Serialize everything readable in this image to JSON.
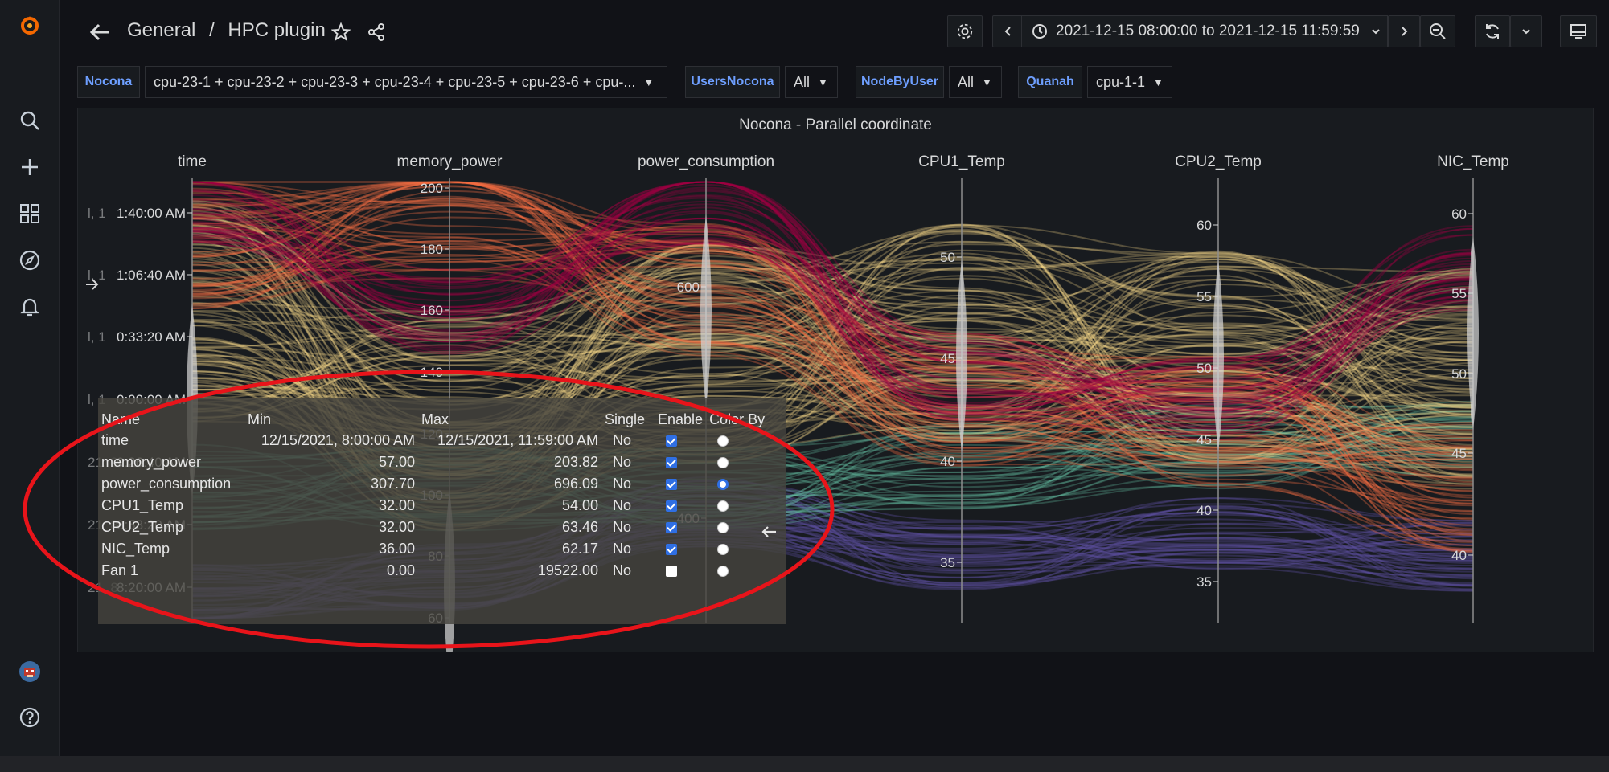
{
  "header": {
    "breadcrumb_folder": "General",
    "breadcrumb_sep": "/",
    "dashboard_title": "HPC plugin",
    "time_range": "2021-12-15 08:00:00 to 2021-12-15 11:59:59"
  },
  "variables": [
    {
      "label": "Nocona",
      "value": "cpu-23-1 + cpu-23-2 + cpu-23-3 + cpu-23-4 + cpu-23-5 + cpu-23-6 + cpu-..."
    },
    {
      "label": "UsersNocona",
      "value": "All"
    },
    {
      "label": "NodeByUser",
      "value": "All"
    },
    {
      "label": "Quanah",
      "value": "cpu-1-1"
    }
  ],
  "panel": {
    "title": "Nocona - Parallel coordinate"
  },
  "chart_data": {
    "type": "parallel-coordinates",
    "title": "Nocona - Parallel coordinate",
    "axes": [
      {
        "name": "time",
        "ticks": [
          "1:40:00 AM",
          "1:06:40 AM",
          "0:33:20 AM",
          "0:00:00 AM",
          "9:26:40 AM",
          "8:53:20 AM",
          "8:20:00 AM"
        ],
        "tick_prefix": [
          "l, 1",
          "l, 1",
          "l, 1",
          "l, 1",
          "21, 9",
          "21, 8",
          "21, 8"
        ]
      },
      {
        "name": "memory_power",
        "ticks": [
          "200",
          "180",
          "160",
          "140",
          "120",
          "100",
          "80",
          "60"
        ]
      },
      {
        "name": "power_consumption",
        "ticks": [
          "600",
          "400"
        ]
      },
      {
        "name": "CPU1_Temp",
        "ticks": [
          "50",
          "45",
          "40",
          "35"
        ]
      },
      {
        "name": "CPU2_Temp",
        "ticks": [
          "60",
          "55",
          "50",
          "45",
          "40",
          "35"
        ]
      },
      {
        "name": "NIC_Temp",
        "ticks": [
          "60",
          "55",
          "50",
          "45",
          "40"
        ]
      }
    ],
    "color_by": "power_consumption",
    "colors": [
      "#5e4fa2",
      "#66c2a5",
      "#fee08b",
      "#f46d43",
      "#9e0142"
    ]
  },
  "info_table": {
    "headers": [
      "Name",
      "Min",
      "Max",
      "Single",
      "Enable",
      "Color By"
    ],
    "rows": [
      {
        "name": "time",
        "min": "12/15/2021, 8:00:00 AM",
        "max": "12/15/2021, 11:59:00 AM",
        "single": "No",
        "enabled": true,
        "color_by": false
      },
      {
        "name": "memory_power",
        "min": "57.00",
        "max": "203.82",
        "single": "No",
        "enabled": true,
        "color_by": false
      },
      {
        "name": "power_consumption",
        "min": "307.70",
        "max": "696.09",
        "single": "No",
        "enabled": true,
        "color_by": true
      },
      {
        "name": "CPU1_Temp",
        "min": "32.00",
        "max": "54.00",
        "single": "No",
        "enabled": true,
        "color_by": false
      },
      {
        "name": "CPU2_Temp",
        "min": "32.00",
        "max": "63.46",
        "single": "No",
        "enabled": true,
        "color_by": false
      },
      {
        "name": "NIC_Temp",
        "min": "36.00",
        "max": "62.17",
        "single": "No",
        "enabled": true,
        "color_by": false
      },
      {
        "name": "Fan 1",
        "min": "0.00",
        "max": "19522.00",
        "single": "No",
        "enabled": false,
        "color_by": false
      }
    ]
  }
}
